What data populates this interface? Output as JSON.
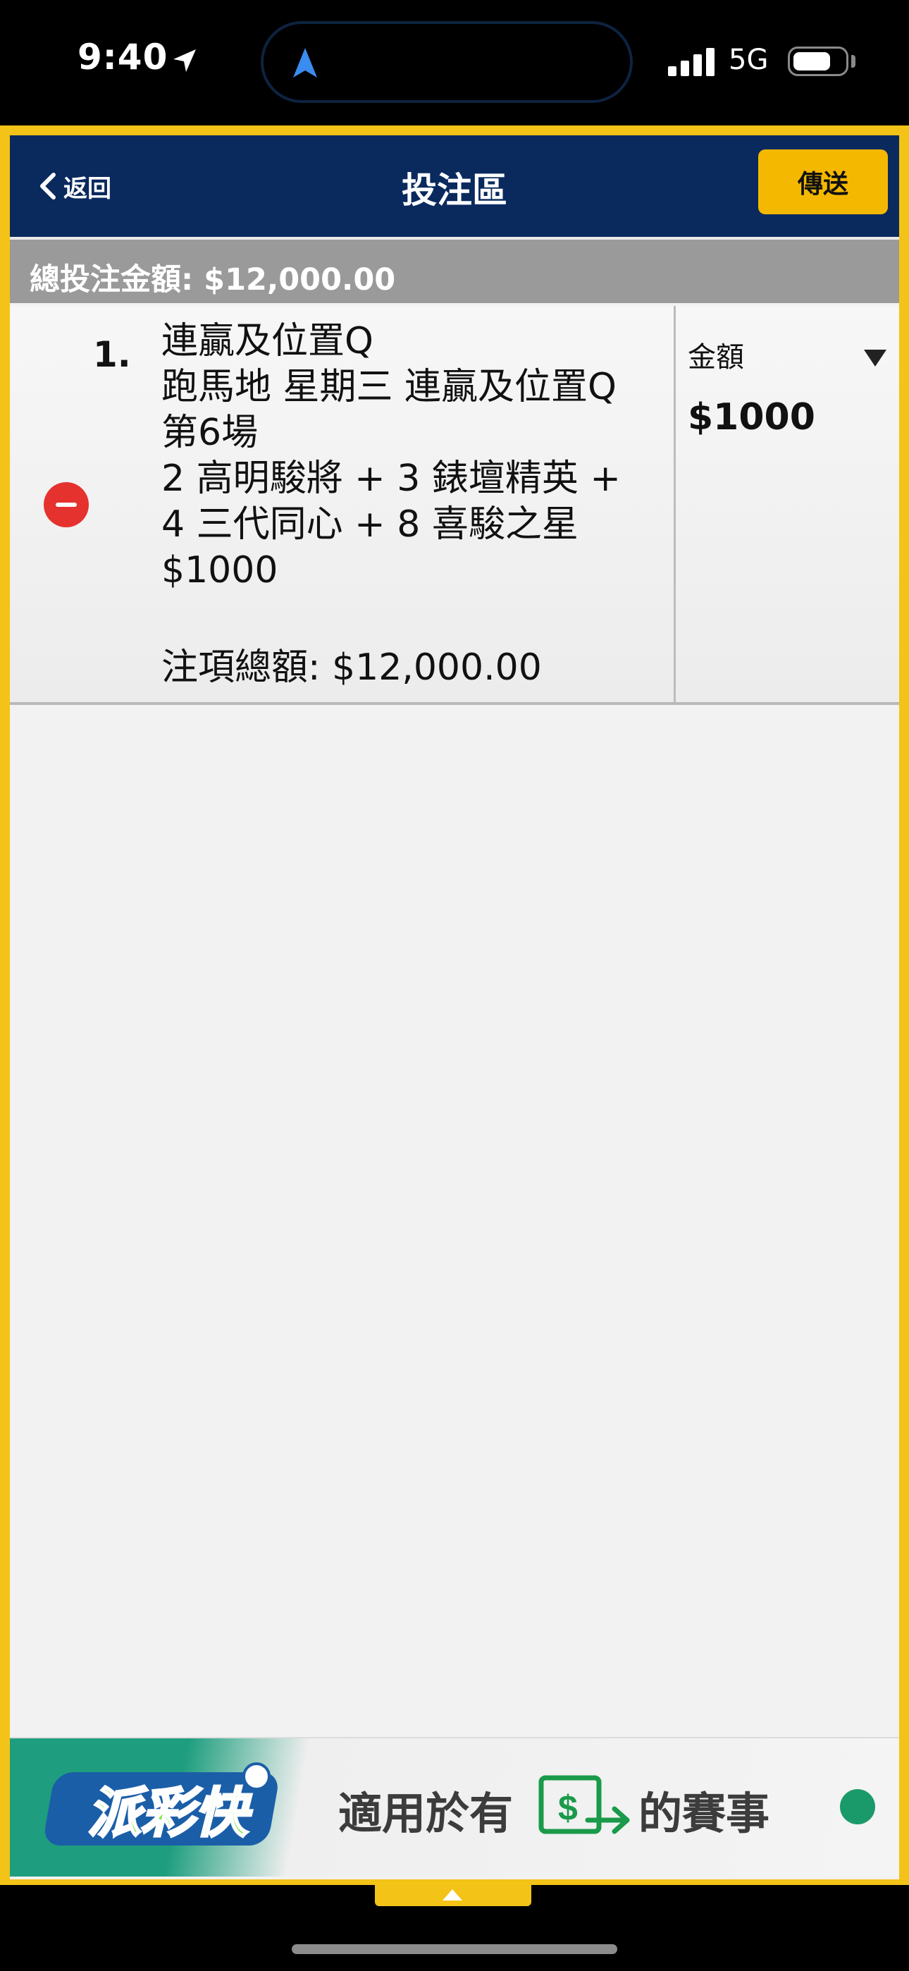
{
  "status_bar": {
    "time": "9:40",
    "network": "5G",
    "icons": [
      "location-arrow-icon",
      "navigation-icon",
      "signal-icon",
      "battery-icon"
    ]
  },
  "header": {
    "back_label": "返回",
    "title": "投注區",
    "send_label": "傳送"
  },
  "total": {
    "text": "總投注金額: $12,000.00"
  },
  "bet": {
    "number": "1.",
    "lines": [
      "連贏及位置Q",
      "跑馬地 星期三 連贏及位置Q",
      "第6場",
      "2 高明駿將 +  3 錶壇精英 +",
      "4 三代同心 +  8 喜駿之星",
      "$1000"
    ],
    "total_line": "注項總額: $12,000.00",
    "amount_label": "金額",
    "amount_value": "$1000"
  },
  "banner": {
    "logo_text": "派彩快",
    "text": "適用於有",
    "suffix": "的賽事"
  },
  "colors": {
    "frame": "#f3c317",
    "header": "#0a2a5e",
    "send_button": "#f5b800",
    "total_bar": "#9a9a9a",
    "remove": "#e5322f"
  }
}
